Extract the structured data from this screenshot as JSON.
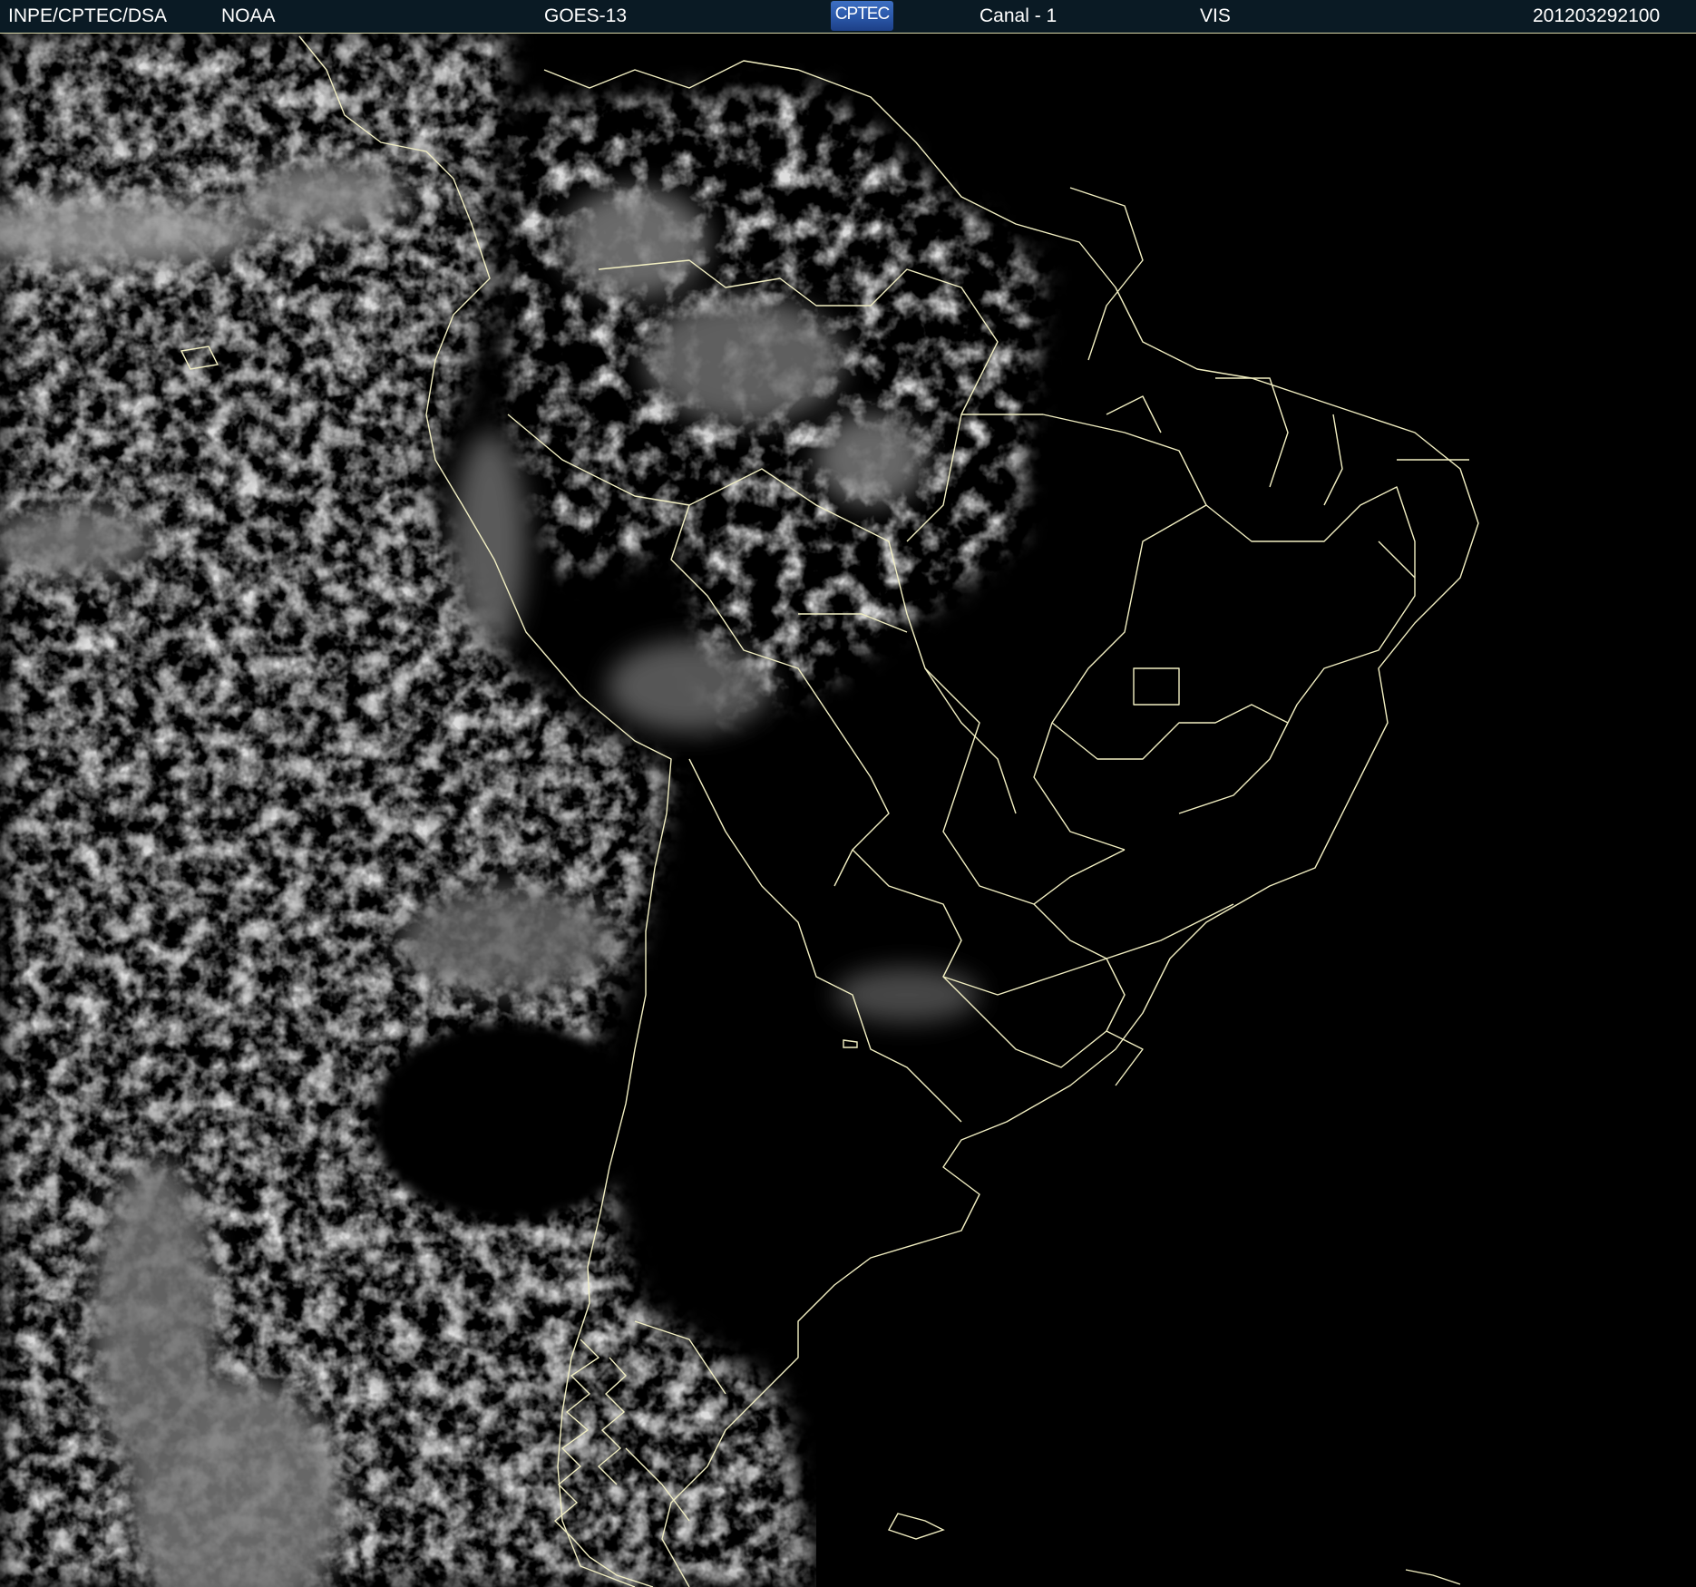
{
  "header": {
    "agency": "INPE/CPTEC/DSA",
    "provider": "NOAA",
    "satellite": "GOES-13",
    "logo_text": "CPTEC",
    "channel": "Canal - 1",
    "band": "VIS",
    "timestamp": "201203292100"
  },
  "colors": {
    "header_background": "#0a1a24",
    "coastline_border": "#f2efc2",
    "space_background": "#000000",
    "cloud": "#b9b9b9",
    "logo_blue": "#2a57a8"
  }
}
